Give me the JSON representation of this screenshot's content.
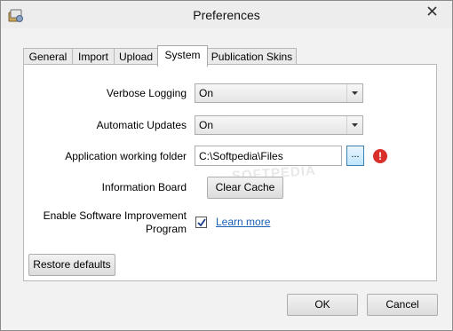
{
  "window": {
    "title": "Preferences"
  },
  "tabs": [
    {
      "label": "General"
    },
    {
      "label": "Import"
    },
    {
      "label": "Upload"
    },
    {
      "label": "System"
    },
    {
      "label": "Publication Skins"
    }
  ],
  "selected_tab": "System",
  "system": {
    "verbose_logging": {
      "label": "Verbose Logging",
      "value": "On"
    },
    "automatic_updates": {
      "label": "Automatic Updates",
      "value": "On"
    },
    "working_folder": {
      "label": "Application working folder",
      "value": "C:\\Softpedia\\Files",
      "browse_label": "...",
      "warning_icon": "error-icon"
    },
    "information_board": {
      "label": "Information Board",
      "button_label": "Clear Cache"
    },
    "improvement_program": {
      "label_line1": "Enable Software Improvement",
      "label_line2": "Program",
      "checked": true,
      "link_label": "Learn more"
    }
  },
  "restore_defaults_label": "Restore defaults",
  "ok_label": "OK",
  "cancel_label": "Cancel",
  "watermark": "SOFTPEDIA",
  "colors": {
    "link": "#1a5fb4",
    "error": "#d9302c",
    "browse_border": "#3c7fb1"
  }
}
